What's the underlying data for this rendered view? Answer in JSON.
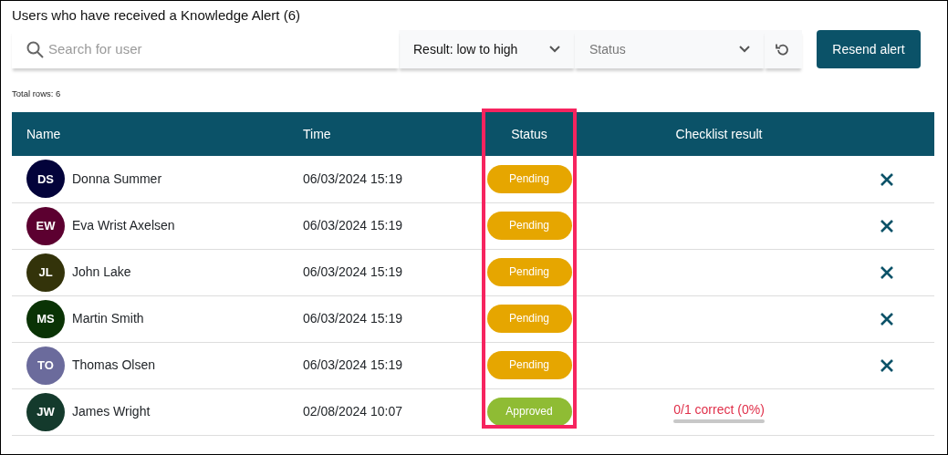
{
  "title": "Users who have received a Knowledge Alert (6)",
  "toolbar": {
    "search": {
      "placeholder": "Search for user"
    },
    "sort": {
      "value": "Result: low to high"
    },
    "status_filter": {
      "placeholder": "Status"
    },
    "button": "Resend alert"
  },
  "total_rows": "Total rows: 6",
  "table": {
    "columns": [
      "Name",
      "Time",
      "Status",
      "Checklist result"
    ],
    "rows": [
      {
        "initials": "DS",
        "color": "#03033a",
        "name": "Donna Summer",
        "time": "06/03/2024 15:19",
        "status": {
          "kind": "pending",
          "label": "Pending"
        },
        "removable": true
      },
      {
        "initials": "EW",
        "color": "#5c0030",
        "name": "Eva Wrist Axelsen",
        "time": "06/03/2024 15:19",
        "status": {
          "kind": "pending",
          "label": "Pending"
        },
        "removable": true
      },
      {
        "initials": "JL",
        "color": "#33330a",
        "name": "John Lake",
        "time": "06/03/2024 15:19",
        "status": {
          "kind": "pending",
          "label": "Pending"
        },
        "removable": true
      },
      {
        "initials": "MS",
        "color": "#0a3305",
        "name": "Martin Smith",
        "time": "06/03/2024 15:19",
        "status": {
          "kind": "pending",
          "label": "Pending"
        },
        "removable": true
      },
      {
        "initials": "TO",
        "color": "#6b6b9c",
        "name": "Thomas Olsen",
        "time": "06/03/2024 15:19",
        "status": {
          "kind": "pending",
          "label": "Pending"
        },
        "removable": true
      },
      {
        "initials": "JW",
        "color": "#143a2c",
        "name": "James Wright",
        "time": "02/08/2024 10:07",
        "status": {
          "kind": "approved",
          "label": "Approved"
        },
        "checklist": {
          "text": "0/1 correct (0%)",
          "level": 0
        },
        "removable": false
      }
    ]
  }
}
